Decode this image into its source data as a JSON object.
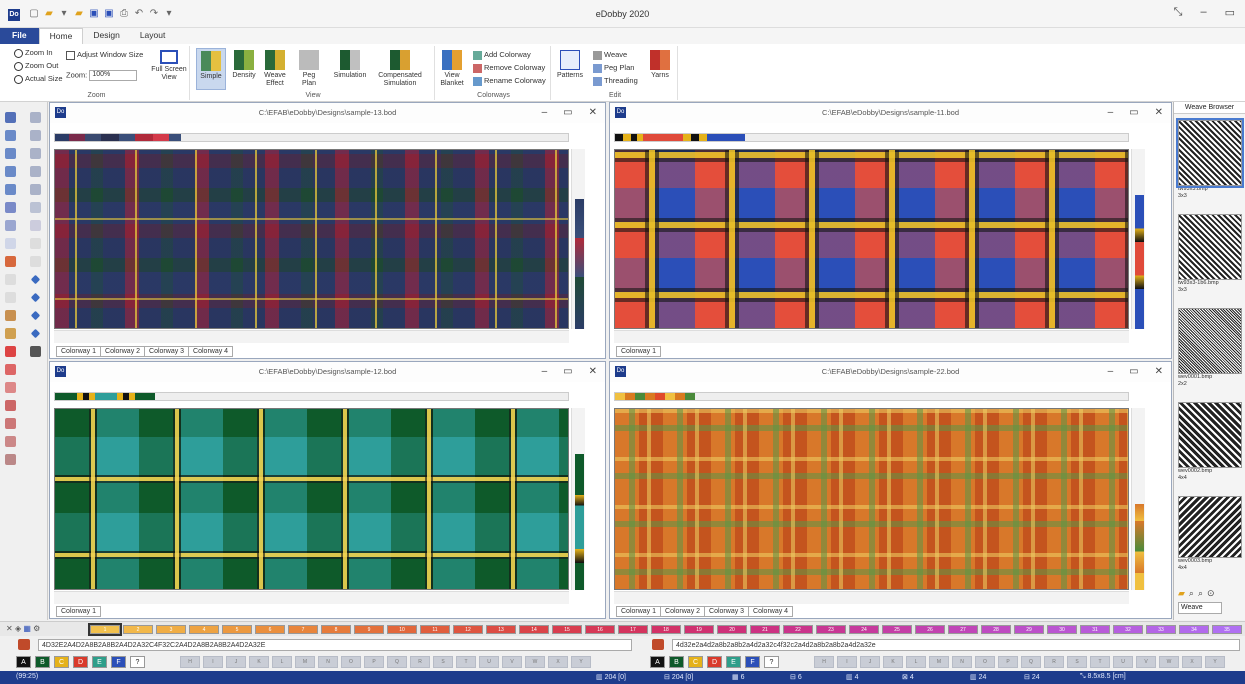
{
  "app": {
    "title": "eDobby 2020",
    "icon_label": "Do"
  },
  "quick_access": [
    "new-icon",
    "open-icon",
    "save-icon",
    "save-as-icon",
    "print-icon",
    "undo-icon",
    "redo-icon"
  ],
  "window_controls": {
    "restore": "⤡",
    "minimize": "–",
    "maximize": "▭"
  },
  "ribbon_tabs": {
    "file": "File",
    "home": "Home",
    "design": "Design",
    "layout": "Layout"
  },
  "ribbon": {
    "zoom": {
      "zoom_in": "Zoom In",
      "zoom_out": "Zoom Out",
      "actual_size": "Actual Size",
      "adjust_window": "Adjust Window Size",
      "zoom_label": "Zoom:",
      "zoom_value": "100%",
      "full_screen": "Full Screen View",
      "group": "Zoom"
    },
    "view": {
      "simple": "Simple",
      "density": "Density",
      "weave_effect": "Weave Effect",
      "peg_plan": "Peg Plan",
      "simulation": "Simulation",
      "compensated": "Compensated Simulation",
      "view_blanket": "View Blanket",
      "group": "View"
    },
    "colorways": {
      "add": "Add Colorway",
      "remove": "Remove Colorway",
      "rename": "Rename Colorway",
      "group": "Colorways"
    },
    "edit": {
      "patterns": "Patterns",
      "weave": "Weave",
      "peg_plan": "Peg Plan",
      "threading": "Threading",
      "yarns": "Yarns",
      "group": "Edit"
    }
  },
  "documents": [
    {
      "path": "C:\\EFAB\\eDobby\\Designs\\sample-13.bod",
      "colorways": [
        "Colorway 1",
        "Colorway 2",
        "Colorway 3",
        "Colorway 4"
      ]
    },
    {
      "path": "C:\\EFAB\\eDobby\\Designs\\sample-11.bod",
      "colorways": [
        "Colorway 1"
      ]
    },
    {
      "path": "C:\\EFAB\\eDobby\\Designs\\sample-12.bod",
      "colorways": [
        "Colorway 1"
      ]
    },
    {
      "path": "C:\\EFAB\\eDobby\\Designs\\sample-22.bod",
      "colorways": [
        "Colorway 1",
        "Colorway 2",
        "Colorway 3",
        "Colorway 4"
      ]
    }
  ],
  "doc_controls": {
    "min": "–",
    "max": "▭",
    "close": "✕"
  },
  "weave_browser": {
    "title": "Weave Browser",
    "items": [
      {
        "file": "tw93x3.bmp",
        "size": "3x3"
      },
      {
        "file": "tw93x3-1b6.bmp",
        "size": "3x3"
      },
      {
        "file": "wev0001.bmp",
        "size": "2x2"
      },
      {
        "file": "wev0002.bmp",
        "size": "4x4"
      },
      {
        "file": "wev0003.bmp",
        "size": "4x4"
      }
    ],
    "select_value": "Weave"
  },
  "palette": {
    "numbers": [
      "1",
      "2",
      "3",
      "4",
      "5",
      "6",
      "7",
      "8",
      "9",
      "10",
      "11",
      "12",
      "13",
      "14",
      "15",
      "16",
      "17",
      "18",
      "19",
      "20",
      "21",
      "22",
      "23",
      "24",
      "25",
      "26",
      "27",
      "28",
      "29",
      "30",
      "31",
      "32",
      "33",
      "34",
      "35"
    ],
    "colors": [
      "#f2c14e",
      "#f2b84a",
      "#f0ad45",
      "#eea342",
      "#ec9940",
      "#ea8f3e",
      "#e8853c",
      "#e67b3b",
      "#e4713b",
      "#e2673b",
      "#e05e3d",
      "#de5540",
      "#dc4c44",
      "#da4449",
      "#d83d4f",
      "#d63856",
      "#d4345e",
      "#d23267",
      "#d03170",
      "#ce3179",
      "#cc3282",
      "#ca348b",
      "#c83794",
      "#c63a9d",
      "#c43ea6",
      "#c242af",
      "#c046b8",
      "#be4bc1",
      "#bc50c9",
      "#ba55d1",
      "#b85ad8",
      "#b65fdf",
      "#b465e6",
      "#b26aec",
      "#b070f2"
    ]
  },
  "warp": {
    "code": "4D32E2A4D2A8B2A8B2A4D2A32C4F32C2A4D2A8B2A8B2A4D2A32E"
  },
  "weft": {
    "code": "4d32e2a4d2a8b2a8b2a4d2a32c4f32c2a4d2a8b2a8b2a4d2a32e"
  },
  "warp_yarns": [
    {
      "label": "A",
      "color": "#111111"
    },
    {
      "label": "B",
      "color": "#0e5a2a"
    },
    {
      "label": "C",
      "color": "#e5b21a"
    },
    {
      "label": "D",
      "color": "#d93a2b"
    },
    {
      "label": "E",
      "color": "#2e9e8a"
    },
    {
      "label": "F",
      "color": "#2b4fb8"
    },
    {
      "label": "?",
      "color": "#ffffff"
    }
  ],
  "weft_yarns": [
    {
      "label": "A",
      "color": "#111111"
    },
    {
      "label": "B",
      "color": "#0e5a2a"
    },
    {
      "label": "C",
      "color": "#e5b21a"
    },
    {
      "label": "D",
      "color": "#d93a2b"
    },
    {
      "label": "E",
      "color": "#2e9e8a"
    },
    {
      "label": "F",
      "color": "#2b4fb8"
    },
    {
      "label": "?",
      "color": "#ffffff"
    }
  ],
  "empty_letters": [
    "H",
    "I",
    "J",
    "K",
    "L",
    "M",
    "N",
    "O",
    "P",
    "Q",
    "R",
    "S",
    "T",
    "U",
    "V",
    "W",
    "X",
    "Y"
  ],
  "status": {
    "coords": "(99:25)",
    "ends": "204 [0]",
    "picks": "204 [0]",
    "shafts": "6",
    "treadles": "6",
    "repeat_x": "4",
    "repeat_y": "4",
    "density_x": "24",
    "density_y": "24",
    "fabric": "8.5x8.5 [cm]"
  }
}
